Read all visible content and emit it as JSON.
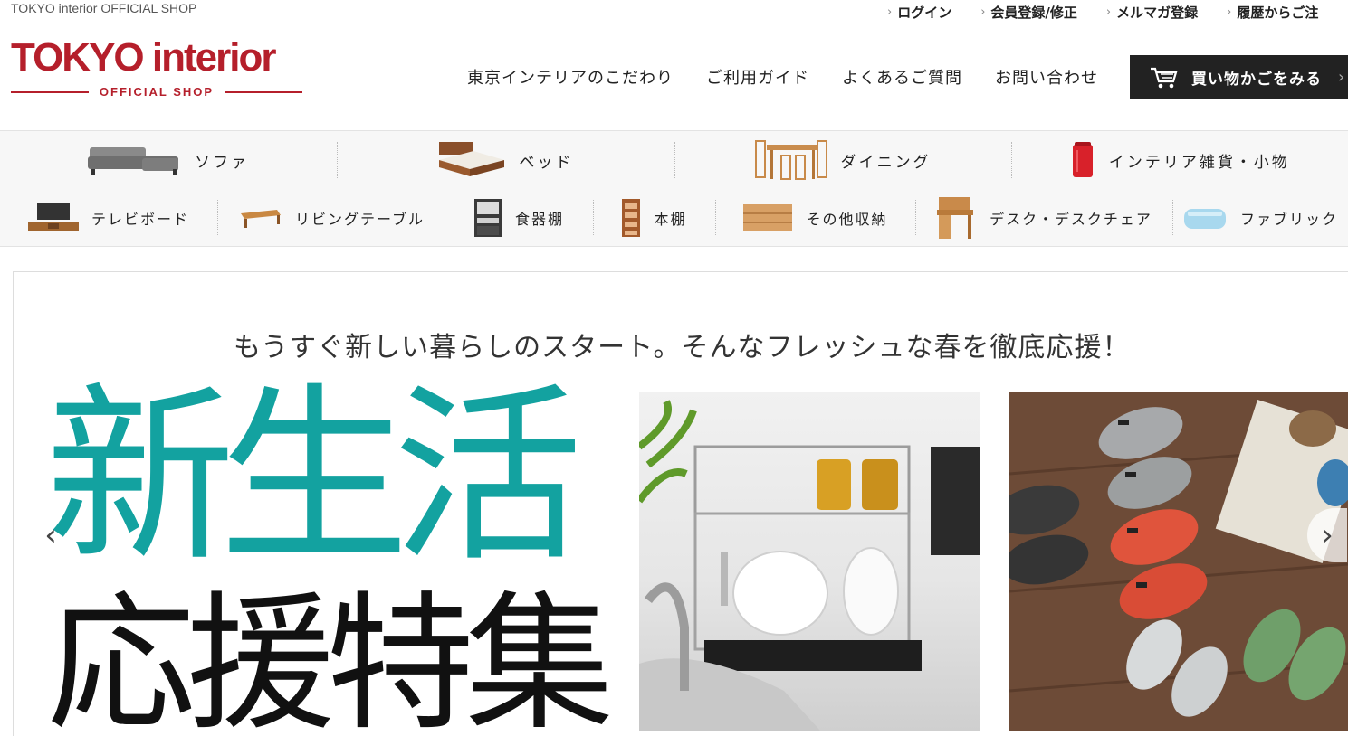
{
  "header": {
    "tagline": "TOKYO interior OFFICIAL SHOP",
    "top_links": [
      "ログイン",
      "会員登録/修正",
      "メルマガ登録",
      "履歴からご注"
    ],
    "logo_main": "TOKYO interior",
    "logo_sub": "OFFICIAL SHOP",
    "nav": [
      "東京インテリアのこだわり",
      "ご利用ガイド",
      "よくあるご質問",
      "お問い合わせ"
    ],
    "cart_label": "買い物かごをみる"
  },
  "categories_primary": [
    {
      "label": "ソファ",
      "icon": "sofa-icon"
    },
    {
      "label": "ベッド",
      "icon": "bed-icon"
    },
    {
      "label": "ダイニング",
      "icon": "dining-set-icon"
    },
    {
      "label": "インテリア雑貨・小物",
      "icon": "trash-can-icon"
    }
  ],
  "categories_secondary": [
    {
      "label": "テレビボード",
      "icon": "tv-board-icon"
    },
    {
      "label": "リビングテーブル",
      "icon": "living-table-icon"
    },
    {
      "label": "食器棚",
      "icon": "cupboard-icon"
    },
    {
      "label": "本棚",
      "icon": "bookshelf-icon"
    },
    {
      "label": "その他収納",
      "icon": "storage-icon"
    },
    {
      "label": "デスク・デスクチェア",
      "icon": "desk-icon"
    },
    {
      "label": "ファブリック",
      "icon": "fabric-icon"
    }
  ],
  "banner": {
    "subtitle": "もうすぐ新しい暮らしのスタート。そんなフレッシュな春を徹底応援！",
    "headline_1": "新生活",
    "headline_2": "応援特集"
  },
  "colors": {
    "brand_red": "#b51f2b",
    "headline_teal": "#13a2a0",
    "cart_bg": "#222222"
  }
}
